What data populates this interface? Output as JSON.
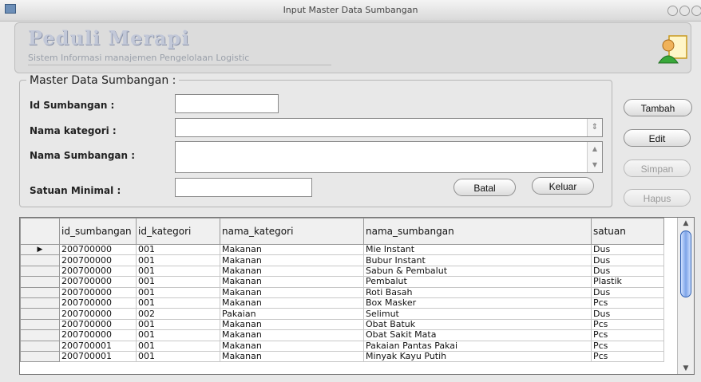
{
  "window": {
    "title": "Input Master Data Sumbangan"
  },
  "header": {
    "brand": "Peduli Merapi",
    "subtitle": "Sistem Informasi manajemen Pengelolaan Logistic"
  },
  "form": {
    "group_title": "Master Data Sumbangan :",
    "id_label": "Id Sumbangan :",
    "kategori_label": "Nama kategori :",
    "nama_label": "Nama Sumbangan :",
    "satuan_label": "Satuan Minimal :",
    "id_value": "",
    "kategori_value": "",
    "nama_value": "",
    "satuan_value": ""
  },
  "buttons": {
    "tambah": "Tambah",
    "edit": "Edit",
    "simpan": "Simpan",
    "hapus": "Hapus",
    "batal": "Batal",
    "keluar": "Keluar"
  },
  "table": {
    "columns": [
      "id_sumbangan",
      "id_kategori",
      "nama_kategori",
      "nama_sumbangan",
      "satuan"
    ],
    "rows": [
      [
        "200700000",
        "001",
        "Makanan",
        "Mie Instant",
        "Dus"
      ],
      [
        "200700000",
        "001",
        "Makanan",
        "Bubur Instant",
        "Dus"
      ],
      [
        "200700000",
        "001",
        "Makanan",
        "Sabun & Pembalut",
        "Dus"
      ],
      [
        "200700000",
        "001",
        "Makanan",
        "Pembalut",
        "Plastik"
      ],
      [
        "200700000",
        "001",
        "Makanan",
        "Roti Basah",
        "Dus"
      ],
      [
        "200700000",
        "001",
        "Makanan",
        "Box Masker",
        "Pcs"
      ],
      [
        "200700000",
        "002",
        "Pakaian",
        "Selimut",
        "Dus"
      ],
      [
        "200700000",
        "001",
        "Makanan",
        "Obat Batuk",
        "Pcs"
      ],
      [
        "200700000",
        "001",
        "Makanan",
        "Obat Sakit Mata",
        "Pcs"
      ],
      [
        "200700001",
        "001",
        "Makanan",
        "Pakaian Pantas Pakai",
        "Pcs"
      ],
      [
        "200700001",
        "001",
        "Makanan",
        "Minyak Kayu Putih",
        "Pcs"
      ]
    ],
    "selected_row_marker": "▶"
  },
  "icons": {
    "window": "app-icon",
    "user": "user-document-icon",
    "row_pointer": "row-pointer-icon"
  }
}
